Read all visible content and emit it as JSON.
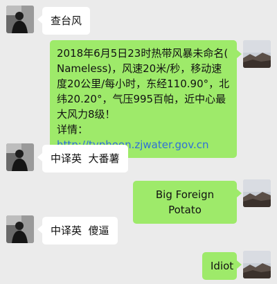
{
  "messages": [
    {
      "side": "left",
      "text": "查台风"
    },
    {
      "side": "right",
      "lines": [
        "2018年6月5日23时热带风暴未命名(",
        "Nameless)，风速20米/秒，移动速",
        "度20公里/每小时，东经110.90°，北",
        "纬20.20°，气压995百帕，近中心最",
        "大风力8级！"
      ],
      "detail_label": "详情：",
      "link": "http://typhoon.zjwater.gov.cn"
    },
    {
      "side": "left",
      "text": "中译英  大番薯"
    },
    {
      "side": "right",
      "text": "Big Foreign Potato"
    },
    {
      "side": "left",
      "text": "中译英  傻逼"
    },
    {
      "side": "right",
      "text": "Idiot"
    }
  ],
  "colors": {
    "background": "#ebebeb",
    "self_bubble": "#9eea6a",
    "other_bubble": "#ffffff",
    "link": "#2f6fd8"
  }
}
